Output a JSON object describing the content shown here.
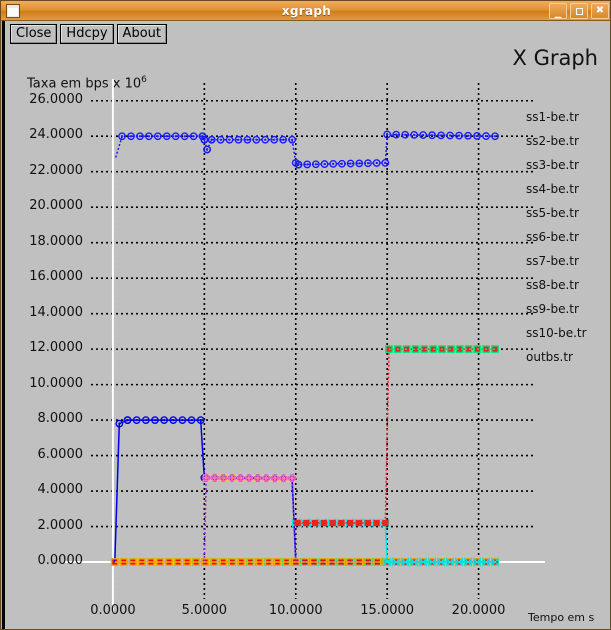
{
  "window": {
    "title": "xgraph",
    "icon": "window-menu-icon",
    "controls": [
      {
        "name": "minimize-button",
        "glyph": "–"
      },
      {
        "name": "maximize-button",
        "glyph": ""
      },
      {
        "name": "close-button",
        "glyph": "✕"
      }
    ]
  },
  "toolbar": {
    "buttons": [
      {
        "name": "close-button",
        "label": "Close"
      },
      {
        "name": "hdcpy-button",
        "label": "Hdcpy"
      },
      {
        "name": "about-button",
        "label": "About"
      }
    ]
  },
  "logo": "X Graph",
  "chart_data": {
    "type": "line",
    "title": "",
    "ylabel": "Taxa em bps x 10",
    "ylabel_exponent": "6",
    "xlabel": "Tempo em s",
    "xlim": [
      -1.2,
      21.5
    ],
    "ylim": [
      -0.9,
      27.0
    ],
    "xticks": [
      0,
      5,
      10,
      15,
      20
    ],
    "xticklabels": [
      "0.0000",
      "5.0000",
      "10.0000",
      "15.0000",
      "20.0000"
    ],
    "yticks": [
      0,
      2,
      4,
      6,
      8,
      10,
      12,
      14,
      16,
      18,
      20,
      22,
      24,
      26
    ],
    "yticklabels": [
      "0.0000",
      "2.0000",
      "4.0000",
      "6.0000",
      "8.0000",
      "10.0000",
      "12.0000",
      "14.0000",
      "16.0000",
      "18.0000",
      "20.0000",
      "22.0000",
      "24.0000",
      "26.0000"
    ],
    "grid": true,
    "legend_position": "right",
    "series": [
      {
        "name": "ss1-be.tr",
        "color": "#ff0000",
        "marker": "square-filled",
        "dashed": true,
        "points": [
          [
            0.1,
            0
          ],
          [
            20.9,
            0
          ]
        ]
      },
      {
        "name": "ss2-be.tr",
        "color": "#00e878",
        "marker": "square-open",
        "dashed": true,
        "points": [
          [
            0.1,
            0
          ],
          [
            14.9,
            0
          ]
        ]
      },
      {
        "name": "ss3-be.tr",
        "color": "#0000ee",
        "marker": "circle-dot",
        "dashed": false,
        "points": [
          [
            0.1,
            0
          ],
          [
            0.35,
            7.8
          ],
          [
            0.8,
            8.0
          ],
          [
            4.8,
            8.0
          ],
          [
            5.0,
            4.75
          ],
          [
            5.1,
            4.75
          ],
          [
            9.8,
            4.72
          ],
          [
            10.0,
            0
          ],
          [
            20.9,
            0
          ]
        ]
      },
      {
        "name": "ss4-be.tr",
        "color": "#ffff00",
        "marker": "x-mark",
        "dashed": true,
        "points": [
          [
            5.1,
            4.75
          ],
          [
            9.8,
            4.72
          ]
        ]
      },
      {
        "name": "ss5-be.tr",
        "color": "#8a2be2",
        "marker": "diamond-open",
        "dashed": true,
        "points": [
          [
            5.0,
            0
          ],
          [
            5.1,
            4.75
          ],
          [
            9.8,
            4.72
          ],
          [
            10.0,
            0
          ]
        ]
      },
      {
        "name": "ss6-be.tr",
        "color": "#ffa500",
        "marker": "square-open",
        "dashed": false,
        "points": [
          [
            0.1,
            0
          ],
          [
            20.9,
            0
          ]
        ]
      },
      {
        "name": "ss7-be.tr",
        "color": "#ff69b4",
        "marker": "circle-plus",
        "dashed": true,
        "points": [
          [
            5.1,
            4.75
          ],
          [
            9.8,
            4.72
          ]
        ]
      },
      {
        "name": "ss8-be.tr",
        "color": "#00e5ee",
        "marker": "bowtie",
        "dashed": false,
        "points": [
          [
            10.0,
            2.2
          ],
          [
            14.9,
            2.2
          ],
          [
            15.0,
            0
          ],
          [
            20.9,
            0
          ]
        ]
      },
      {
        "name": "ss9-be.tr",
        "color": "#ee2222",
        "marker": "square-filled",
        "dashed": true,
        "points": [
          [
            10.1,
            2.2
          ],
          [
            14.9,
            2.2
          ],
          [
            15.1,
            12.0
          ],
          [
            20.9,
            12.0
          ]
        ]
      },
      {
        "name": "ss10-be.tr",
        "color": "#00e878",
        "marker": "square-open",
        "dashed": true,
        "points": [
          [
            15.1,
            12.0
          ],
          [
            20.9,
            12.0
          ]
        ]
      },
      {
        "name": "outbs.tr",
        "color": "#1a1aff",
        "marker": "circle-dot",
        "dashed": true,
        "points": [
          [
            0.15,
            22.8
          ],
          [
            0.5,
            24.0
          ],
          [
            4.9,
            24.0
          ],
          [
            5.0,
            23.8
          ],
          [
            5.15,
            23.25
          ],
          [
            5.4,
            23.8
          ],
          [
            9.8,
            23.8
          ],
          [
            10.0,
            22.5
          ],
          [
            10.15,
            22.4
          ],
          [
            14.9,
            22.5
          ],
          [
            15.0,
            24.1
          ],
          [
            20.9,
            24.0
          ]
        ]
      }
    ]
  },
  "legend": {
    "entries": [
      {
        "label": "ss1-be.tr",
        "color": "#ff0000",
        "marker": "square-filled",
        "dashed": true
      },
      {
        "label": "ss2-be.tr",
        "color": "#00e878",
        "marker": "square-open",
        "dashed": true
      },
      {
        "label": "ss3-be.tr",
        "color": "#0000ee",
        "marker": "circle-dot",
        "dashed": false
      },
      {
        "label": "ss4-be.tr",
        "color": "#ffff00",
        "marker": "x-mark",
        "dashed": true
      },
      {
        "label": "ss5-be.tr",
        "color": "#8a2be2",
        "marker": "diamond-open",
        "dashed": true
      },
      {
        "label": "ss6-be.tr",
        "color": "#ffa500",
        "marker": "square-open",
        "dashed": false
      },
      {
        "label": "ss7-be.tr",
        "color": "#ff69b4",
        "marker": "circle-plus",
        "dashed": true
      },
      {
        "label": "ss8-be.tr",
        "color": "#00e5ee",
        "marker": "bowtie",
        "dashed": false
      },
      {
        "label": "ss9-be.tr",
        "color": "#ee2222",
        "marker": "square-filled",
        "dashed": true
      },
      {
        "label": "ss10-be.tr",
        "color": "#00e878",
        "marker": "square-open",
        "dashed": true
      },
      {
        "label": "outbs.tr",
        "color": "#1a1aff",
        "marker": "circle-dot",
        "dashed": true
      }
    ]
  }
}
